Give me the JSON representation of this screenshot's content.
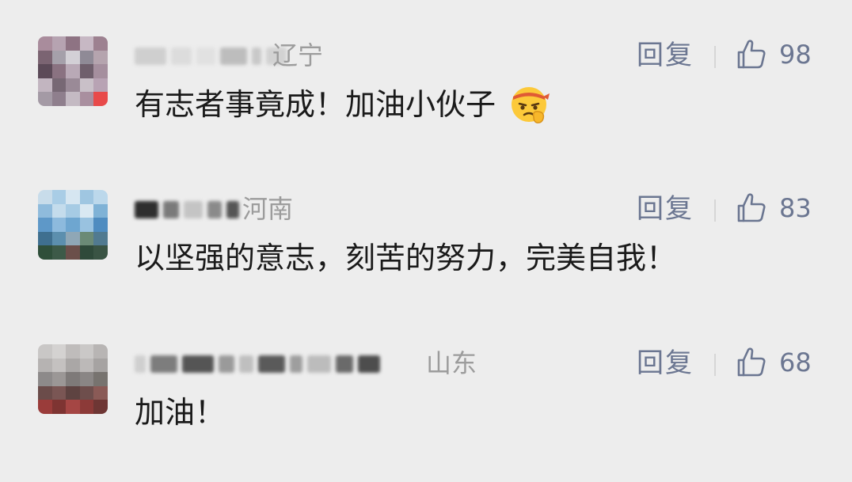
{
  "comments": [
    {
      "region": "辽宁",
      "reply_label": "回复",
      "likes": "98",
      "text": "有志者事竟成！加油小伙子",
      "emoji": "determined-face-with-headband-emoji"
    },
    {
      "region": "河南",
      "reply_label": "回复",
      "likes": "83",
      "text": "以坚强的意志，刻苦的努力，完美自我！"
    },
    {
      "region": "山东",
      "reply_label": "回复",
      "likes": "68",
      "text": "加油！"
    }
  ],
  "icons": {
    "like": "thumbs-up-icon"
  },
  "colors": {
    "background": "#ededed",
    "meta_text": "#9c9c9c",
    "action_text": "#6b7691",
    "body_text": "#1a1a1a"
  }
}
